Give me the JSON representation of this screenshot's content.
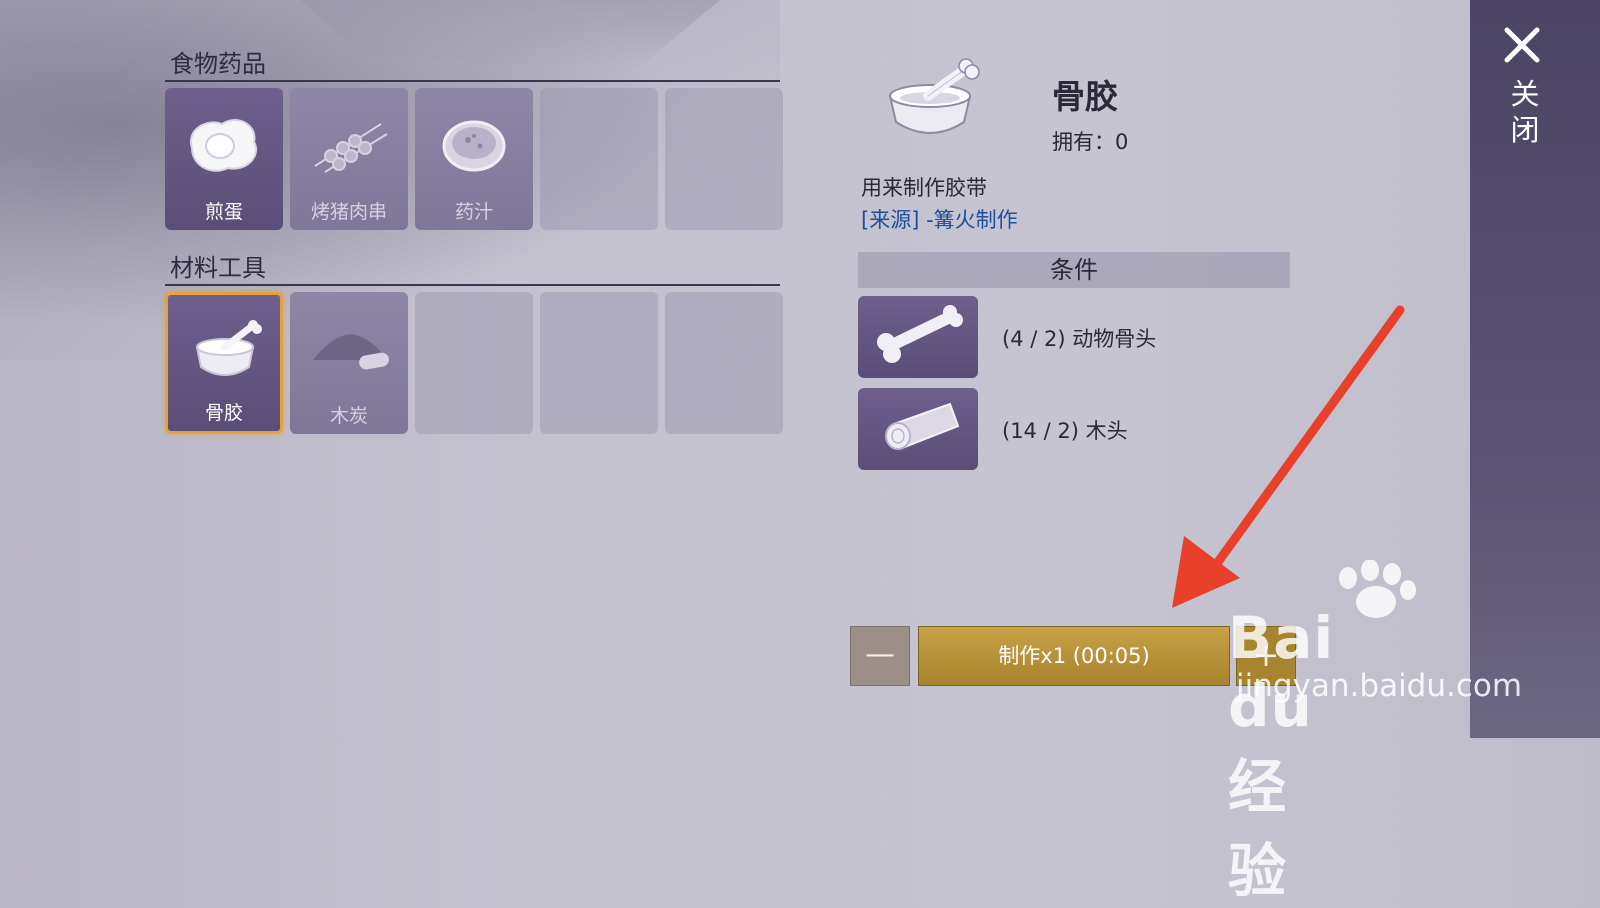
{
  "sections": {
    "food": {
      "title": "食物药品"
    },
    "materials": {
      "title": "材料工具"
    }
  },
  "food_slots": [
    {
      "label": "煎蛋",
      "icon": "fried-egg-icon"
    },
    {
      "label": "烤猪肉串",
      "icon": "skewer-icon"
    },
    {
      "label": "药汁",
      "icon": "potion-bowl-icon"
    },
    {
      "label": ""
    },
    {
      "label": ""
    }
  ],
  "material_slots": [
    {
      "label": "骨胶",
      "icon": "bone-glue-icon",
      "selected": true
    },
    {
      "label": "木炭",
      "icon": "charcoal-icon"
    },
    {
      "label": ""
    },
    {
      "label": ""
    },
    {
      "label": ""
    }
  ],
  "detail": {
    "name": "骨胶",
    "owned_label": "拥有：",
    "owned_value": "0",
    "description": "用来制作胶带",
    "source_tag": "[来源]",
    "source_text": " -篝火制作"
  },
  "conditions": {
    "header": "条件",
    "items": [
      {
        "text": "(4 / 2) 动物骨头",
        "icon": "animal-bone-icon"
      },
      {
        "text": "(14 / 2) 木头",
        "icon": "wood-log-icon"
      }
    ]
  },
  "craft": {
    "minus_label": "—",
    "button_label": "制作x1 (00:05)",
    "plus_label": "+"
  },
  "panel": {
    "close_label": "关闭"
  },
  "watermark": {
    "logo": "Bai du 经验",
    "url": "jingyan.baidu.com"
  },
  "colors": {
    "accent_gold": "#c8a145",
    "selected_border": "#e6a23a",
    "annotation_arrow": "#e8402a",
    "slot_purple": "#6e5f8c"
  }
}
